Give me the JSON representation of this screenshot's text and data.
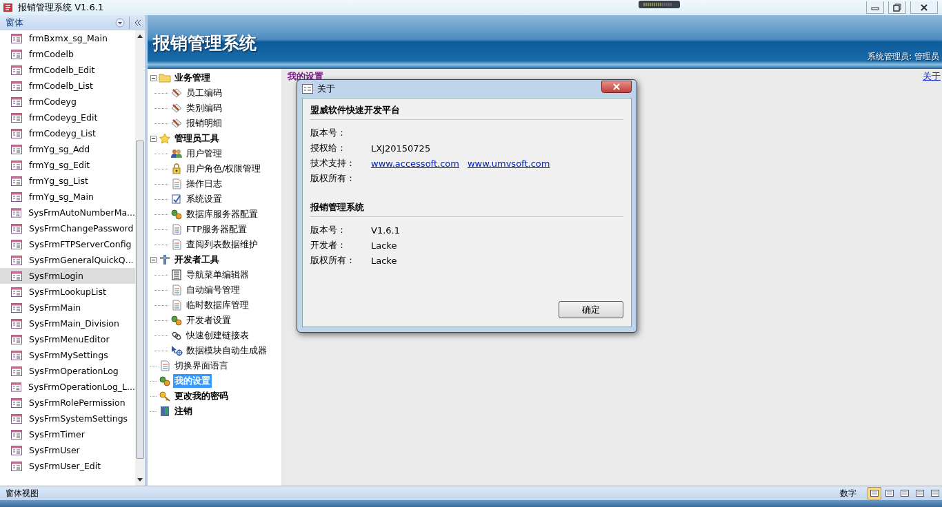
{
  "window": {
    "title": "报销管理系统 V1.6.1"
  },
  "nav_pane": {
    "title": "窗体",
    "items": [
      {
        "label": "frmBxmx_sg_Main",
        "selected": false
      },
      {
        "label": "frmCodelb",
        "selected": false
      },
      {
        "label": "frmCodelb_Edit",
        "selected": false
      },
      {
        "label": "frmCodelb_List",
        "selected": false
      },
      {
        "label": "frmCodeyg",
        "selected": false
      },
      {
        "label": "frmCodeyg_Edit",
        "selected": false
      },
      {
        "label": "frmCodeyg_List",
        "selected": false
      },
      {
        "label": "frmYg_sg_Add",
        "selected": false
      },
      {
        "label": "frmYg_sg_Edit",
        "selected": false
      },
      {
        "label": "frmYg_sg_List",
        "selected": false
      },
      {
        "label": "frmYg_sg_Main",
        "selected": false
      },
      {
        "label": "SysFrmAutoNumberMa...",
        "selected": false
      },
      {
        "label": "SysFrmChangePassword",
        "selected": false
      },
      {
        "label": "SysFrmFTPServerConfig",
        "selected": false
      },
      {
        "label": "SysFrmGeneralQuickQ...",
        "selected": false
      },
      {
        "label": "SysFrmLogin",
        "selected": true
      },
      {
        "label": "SysFrmLookupList",
        "selected": false
      },
      {
        "label": "SysFrmMain",
        "selected": false
      },
      {
        "label": "SysFrmMain_Division",
        "selected": false
      },
      {
        "label": "SysFrmMenuEditor",
        "selected": false
      },
      {
        "label": "SysFrmMySettings",
        "selected": false
      },
      {
        "label": "SysFrmOperationLog",
        "selected": false
      },
      {
        "label": "SysFrmOperationLog_L...",
        "selected": false
      },
      {
        "label": "SysFrmRolePermission",
        "selected": false
      },
      {
        "label": "SysFrmSystemSettings",
        "selected": false
      },
      {
        "label": "SysFrmTimer",
        "selected": false
      },
      {
        "label": "SysFrmUser",
        "selected": false
      },
      {
        "label": "SysFrmUser_Edit",
        "selected": false
      }
    ]
  },
  "header": {
    "title": "报销管理系统",
    "user": "系统管理员: 管理员"
  },
  "tree": [
    {
      "label": "业务管理",
      "selected": false,
      "expanded": true,
      "children": [
        {
          "label": "员工编码",
          "selected": false
        },
        {
          "label": "类别编码",
          "selected": false
        },
        {
          "label": "报销明细",
          "selected": false
        }
      ]
    },
    {
      "label": "管理员工具",
      "selected": false,
      "expanded": true,
      "children": [
        {
          "label": "用户管理",
          "selected": false
        },
        {
          "label": "用户角色/权限管理",
          "selected": false
        },
        {
          "label": "操作日志",
          "selected": false
        },
        {
          "label": "系统设置",
          "selected": false
        },
        {
          "label": "数据库服务器配置",
          "selected": false
        },
        {
          "label": "FTP服务器配置",
          "selected": false
        },
        {
          "label": "查阅列表数据维护",
          "selected": false
        }
      ]
    },
    {
      "label": "开发者工具",
      "selected": false,
      "expanded": true,
      "children": [
        {
          "label": "导航菜单编辑器",
          "selected": false
        },
        {
          "label": "自动编号管理",
          "selected": false
        },
        {
          "label": "临时数据库管理",
          "selected": false
        },
        {
          "label": "开发者设置",
          "selected": false
        },
        {
          "label": "快速创建链接表",
          "selected": false
        },
        {
          "label": "数据模块自动生成器",
          "selected": false
        }
      ]
    },
    {
      "label": "切换界面语言",
      "selected": false
    },
    {
      "label": "我的设置",
      "selected": true
    },
    {
      "label": "更改我的密码",
      "selected": false
    },
    {
      "label": "注销",
      "selected": false
    }
  ],
  "content": {
    "heading": "我的设置",
    "about_link": "关于"
  },
  "dialog": {
    "title": "关于",
    "sections": [
      {
        "title": "盟威软件快速开发平台",
        "rows": [
          {
            "label": "版本号："
          },
          {
            "label": "授权给：",
            "value": "LXJ20150725"
          },
          {
            "label": "技术支持：",
            "links": [
              "www.accessoft.com",
              "www.umvsoft.com"
            ]
          },
          {
            "label": "版权所有："
          }
        ]
      },
      {
        "title": "报销管理系统",
        "rows": [
          {
            "label": "版本号：",
            "value": "V1.6.1"
          },
          {
            "label": "开发者：",
            "value": "Lacke"
          },
          {
            "label": "版权所有：",
            "value": "Lacke"
          }
        ]
      }
    ],
    "ok_button": "确定"
  },
  "status_bar": {
    "view": "窗体视图",
    "mode": "数字",
    "view_buttons": [
      {
        "selected": true
      },
      {
        "selected": false
      },
      {
        "selected": false
      },
      {
        "selected": false
      },
      {
        "selected": false
      }
    ]
  }
}
